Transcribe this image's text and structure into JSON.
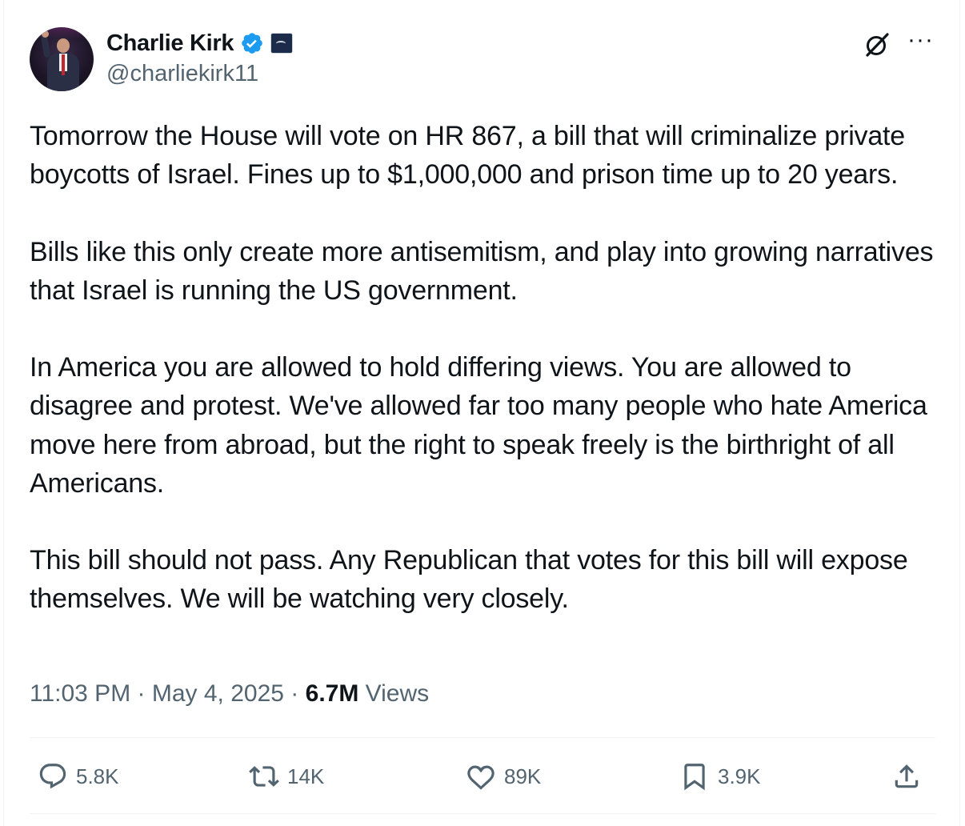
{
  "author": {
    "display_name": "Charlie Kirk",
    "handle": "@charliekirk11",
    "verified_icon": "verified-badge-icon",
    "affiliation_icon": "affiliation-badge-icon",
    "accent_color": "#1d9bf0"
  },
  "header_actions": {
    "grok_icon": "grok-icon",
    "more_label": "···"
  },
  "post": {
    "text": "Tomorrow the House will vote on HR 867, a bill that will criminalize private boycotts of Israel. Fines up to $1,000,000 and prison time up to 20 years.\n\nBills like this only create more antisemitism, and play into growing narratives that Israel is running the US government.\n\nIn America you are allowed to hold differing views. You are allowed to disagree and protest. We've allowed far too many people who hate America move here from abroad, but the right to speak freely is the birthright of all Americans.\n\nThis bill should not pass. Any Republican that votes for this bill will expose themselves. We will be watching very closely."
  },
  "meta": {
    "time": "11:03 PM",
    "separator": " · ",
    "date": "May 4, 2025",
    "views_count": "6.7M",
    "views_label": " Views"
  },
  "actions": {
    "reply": {
      "icon": "reply-icon",
      "count": "5.8K"
    },
    "repost": {
      "icon": "repost-icon",
      "count": "14K"
    },
    "like": {
      "icon": "heart-icon",
      "count": "89K"
    },
    "bookmark": {
      "icon": "bookmark-icon",
      "count": "3.9K"
    },
    "share": {
      "icon": "share-icon"
    }
  }
}
